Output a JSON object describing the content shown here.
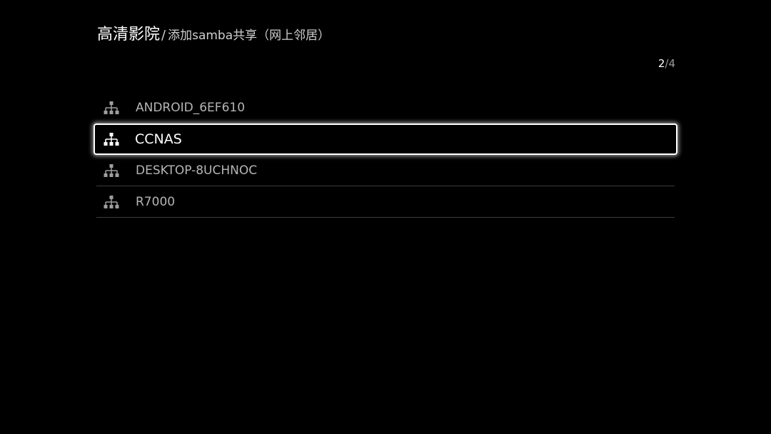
{
  "header": {
    "app_title": "高清影院",
    "separator": "/",
    "current_page": "添加samba共享（网上邻居）"
  },
  "pager": {
    "current": "2",
    "separator": "/",
    "total": "4"
  },
  "devices": [
    {
      "name": "ANDROID_6EF610",
      "icon": "network-tree-icon",
      "selected": false
    },
    {
      "name": "CCNAS",
      "icon": "network-tree-icon",
      "selected": true
    },
    {
      "name": "DESKTOP-8UCHNOC",
      "icon": "network-tree-icon",
      "selected": false
    },
    {
      "name": "R7000",
      "icon": "network-tree-icon",
      "selected": false
    }
  ],
  "colors": {
    "background": "#000000",
    "text_primary": "#ffffff",
    "text_secondary": "#b5b5b5",
    "divider": "#3c3c3c",
    "focus_border": "#ffffff"
  }
}
